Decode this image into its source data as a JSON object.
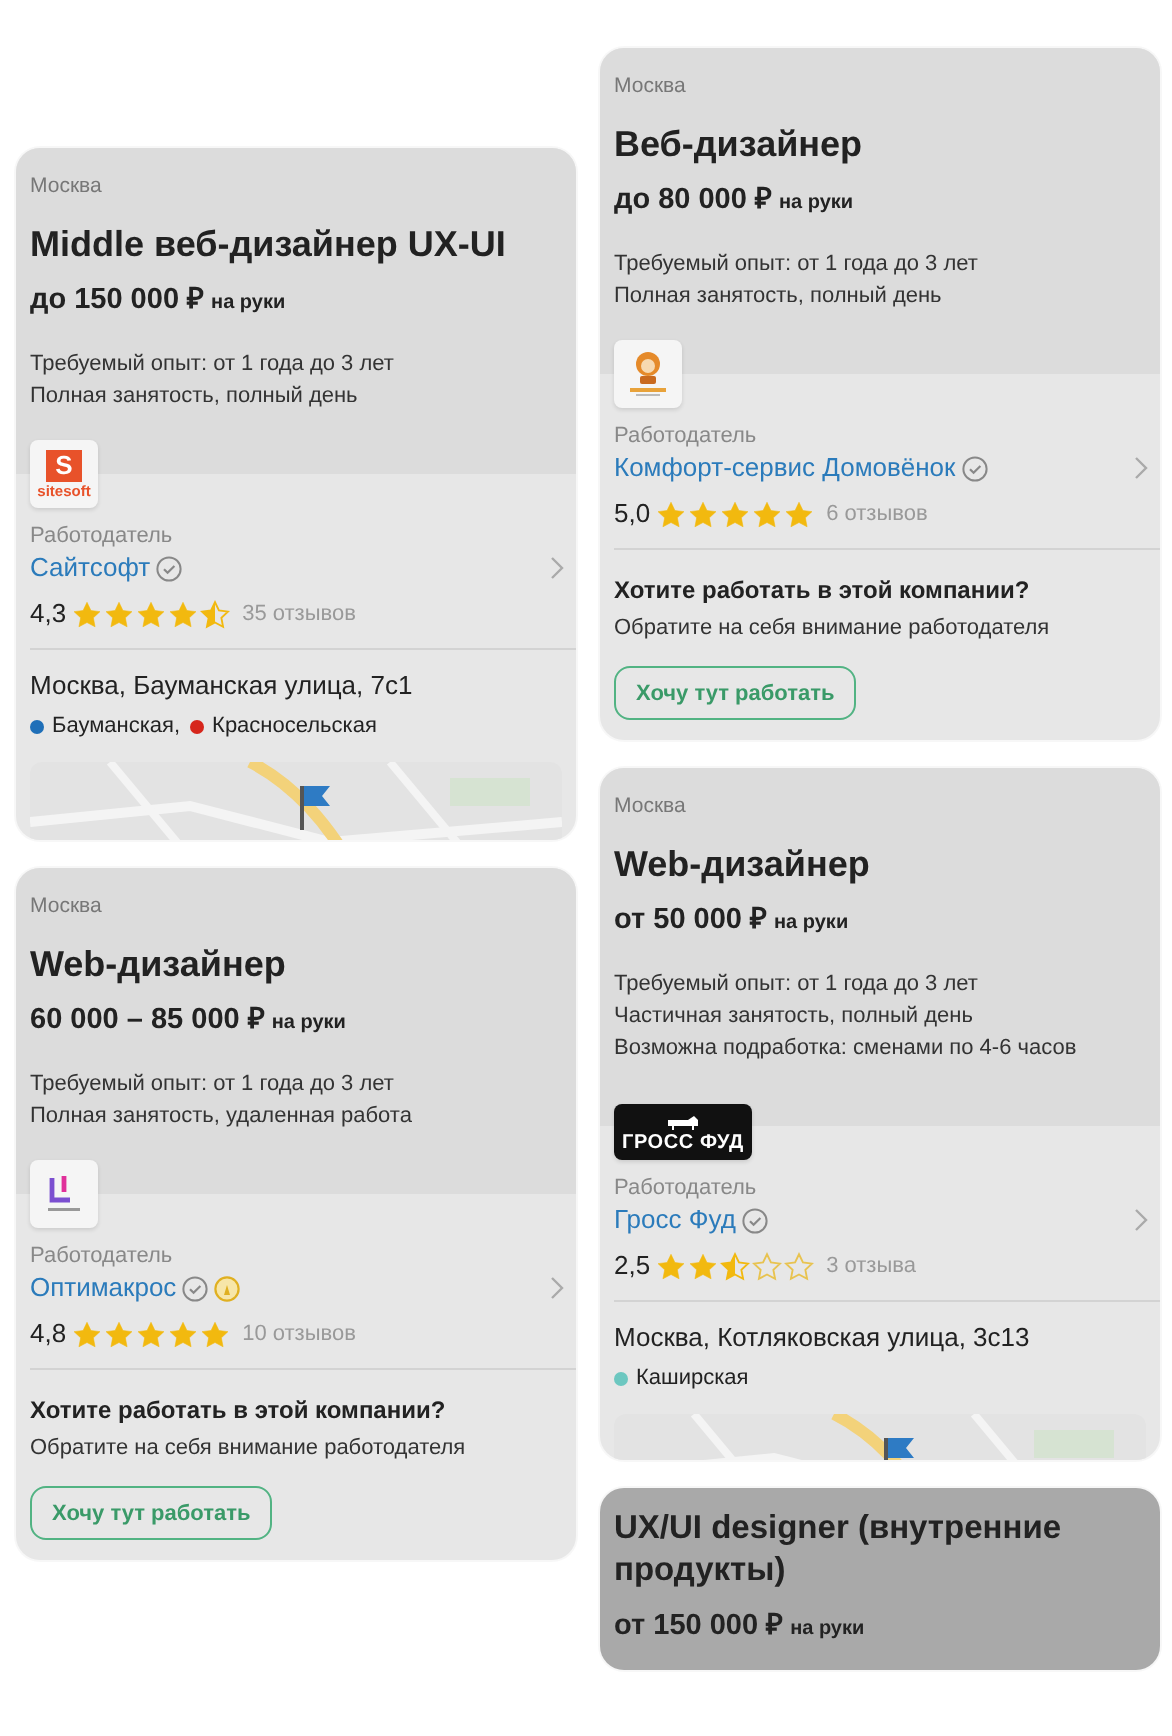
{
  "columns": [
    {
      "cards": [
        {
          "kind": "full",
          "city": "Москва",
          "title": "Middle веб-дизайнер UX-UI",
          "salary": {
            "amount": "до 150 000 ₽",
            "suffix": "на руки"
          },
          "details": [
            "Требуемый опыт: от 1 года до 3 лет",
            "Полная занятость, полный день"
          ],
          "logo": {
            "kind": "letter-tile",
            "mark": "S",
            "text": "sitesoft"
          },
          "employer": {
            "label": "Работодатель",
            "name": "Сайтсофт",
            "badges": [
              {
                "kind": "verified"
              }
            ],
            "rating": "4,3",
            "stars": 4.5,
            "reviews": "35 отзывов"
          },
          "section": {
            "kind": "address",
            "address": "Москва, Бауманская улица, 7с1",
            "metro": [
              {
                "name": "Бауманская,",
                "color": "#1f6fb8"
              },
              {
                "name": "Красносельская",
                "color": "#d6261c"
              }
            ]
          }
        },
        {
          "kind": "full",
          "city": "Москва",
          "title": "Web-дизайнер",
          "salary": {
            "amount": "60 000 – 85 000 ₽",
            "suffix": "на руки"
          },
          "details": [
            "Требуемый опыт: от 1 года до 3 лет",
            "Полная занятость, удаленная работа"
          ],
          "logo": {
            "kind": "bracket"
          },
          "employer": {
            "label": "Работодатель",
            "name": "Оптимакрос",
            "badges": [
              {
                "kind": "verified"
              },
              {
                "kind": "award"
              }
            ],
            "rating": "4,8",
            "stars": 5,
            "reviews": "10 отзывов"
          },
          "section": {
            "kind": "cta",
            "question": "Хотите работать в этой компании?",
            "hint": "Обратите на себя внимание работодателя",
            "button": "Хочу тут работать"
          }
        }
      ]
    },
    {
      "cards": [
        {
          "kind": "full",
          "city": "Москва",
          "title": "Веб-дизайнер",
          "salary": {
            "amount": "до 80 000 ₽",
            "suffix": "на руки"
          },
          "details": [
            "Требуемый опыт: от 1 года до 3 лет",
            "Полная занятость, полный день"
          ],
          "logo": {
            "kind": "mascot"
          },
          "employer": {
            "label": "Работодатель",
            "name": "Комфорт-сервис Домовёнок",
            "badges": [
              {
                "kind": "verified"
              }
            ],
            "rating": "5,0",
            "stars": 5,
            "reviews": "6 отзывов"
          },
          "section": {
            "kind": "cta",
            "question": "Хотите работать в этой компании?",
            "hint": "Обратите на себя внимание работодателя",
            "button": "Хочу тут работать"
          }
        },
        {
          "kind": "full",
          "city": "Москва",
          "title": "Web-дизайнер",
          "salary": {
            "amount": "от 50 000 ₽",
            "suffix": "на руки"
          },
          "details": [
            "Требуемый опыт: от 1 года до 3 лет",
            "Частичная занятость, полный день",
            "Возможна подработка: сменами по 4-6 часов"
          ],
          "logo": {
            "kind": "dark-plate",
            "text": "ГРОСС ФУД"
          },
          "employer": {
            "label": "Работодатель",
            "name": "Гросс Фуд",
            "badges": [
              {
                "kind": "verified"
              }
            ],
            "rating": "2,5",
            "stars": 2.5,
            "reviews": "3 отзыва"
          },
          "section": {
            "kind": "address",
            "address": "Москва, Котляковская улица, 3с13",
            "metro": [
              {
                "name": "Каширская",
                "color": "#6cc7c0"
              }
            ]
          }
        },
        {
          "kind": "collapsed",
          "title": "UX/UI designer (внутренние продукты)",
          "salary": {
            "amount": "от 150 000 ₽",
            "suffix": "на руки"
          }
        }
      ]
    }
  ]
}
